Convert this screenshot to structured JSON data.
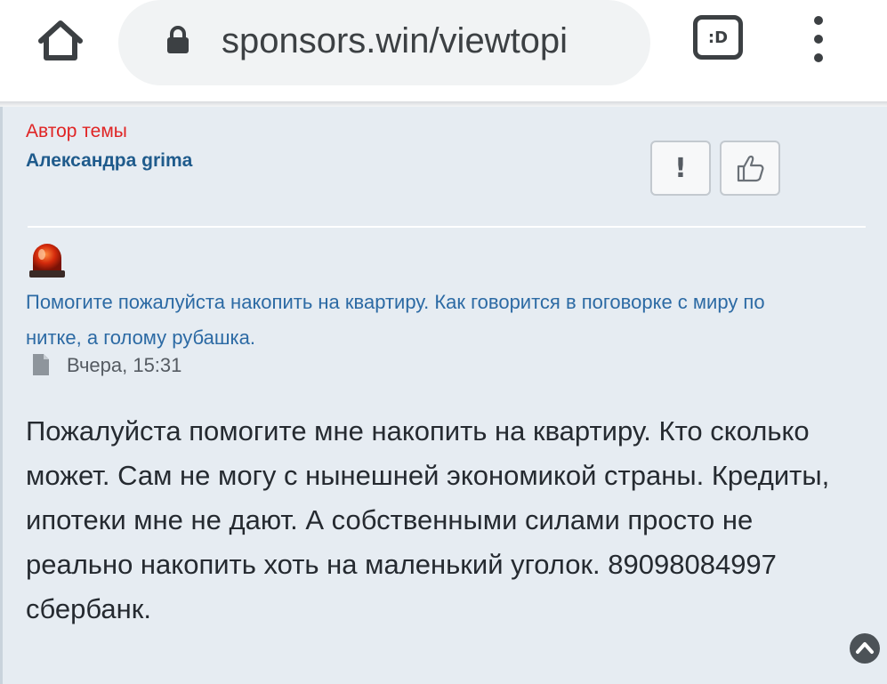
{
  "browser": {
    "url": "sponsors.win/viewtopi",
    "tab_switcher_label": ":D",
    "icons": [
      "home-icon",
      "lock-icon",
      "tab-switcher-icon",
      "more-vert-icon"
    ]
  },
  "post": {
    "author_label": "Автор темы",
    "author_name": "Александра grima",
    "topic_title": "Помогите пожалуйста накопить на квартиру. Как говорится в поговорке с миру по нитке, а голому рубашка.",
    "timestamp": "Вчера, 15:31",
    "body": "Пожалуйста помогите мне накопить на квартиру. Кто сколько может. Сам не могу с нынешней экономикой страны. Кредиты, ипотеки мне не дают. А собственными силами просто не реально накопить хоть на маленький уголок. 89098084997 сбербанк.",
    "report_label": "!",
    "icons": [
      "report-icon",
      "thumbs-up-icon",
      "siren-icon",
      "file-icon",
      "scroll-top-icon"
    ]
  },
  "colors": {
    "author_label": "#e02424",
    "author_name": "#1f5b8c",
    "link": "#2c6aa4",
    "post_background": "#e6ecf2",
    "text": "#252a30"
  }
}
